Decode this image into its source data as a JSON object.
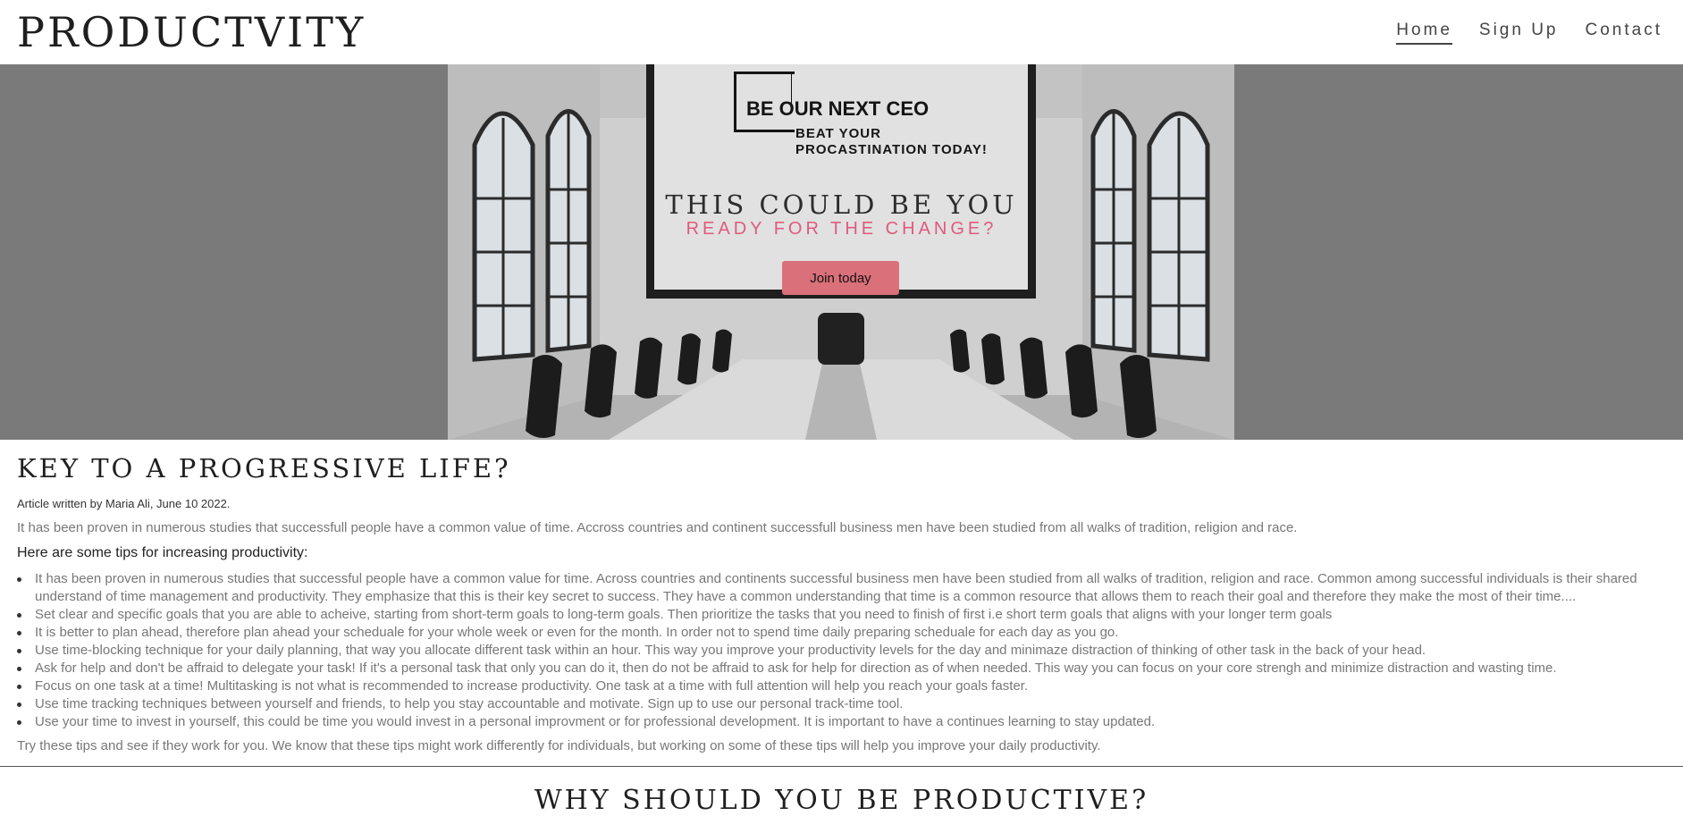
{
  "header": {
    "logo": "PRODUCTVITY",
    "nav": [
      {
        "label": "Home"
      },
      {
        "label": "Sign Up"
      },
      {
        "label": "Contact"
      }
    ]
  },
  "hero": {
    "image_text_line1": "BE OUR NEXT CEO",
    "image_text_line2": "BEAT YOUR",
    "image_text_line3": "PROCASTINATION TODAY!",
    "title": "THIS COULD BE YOU",
    "subtitle": "READY FOR THE CHANGE?",
    "button_label": "Join today"
  },
  "article": {
    "title": "KEY TO A PROGRESSIVE LIFE?",
    "byline": "Article written by Maria Ali, June 10 2022.",
    "intro": "It has been proven in numerous studies that successfull people have a common value of time. Accross countries and continent successfull business men have been studied from all walks of tradition, religion and race.",
    "tips_heading": "Here are some tips for increasing productivity:",
    "tips": [
      "It has been proven in numerous studies that successful people have a common value for time. Across countries and continents successful business men have been studied from all walks of tradition, religion and race. Common among successful individuals is their shared understand of time management and productivity. They emphasize that this is their key secret to success. They have a common understanding that time is a common resource that allows them to reach their goal and therefore they make the most of their time....",
      "Set clear and specific goals that you are able to acheive, starting from short-term goals to long-term goals. Then prioritize the tasks that you need to finish of first i.e short term goals that aligns with your longer term goals",
      "It is better to plan ahead, therefore plan ahead your scheduale for your whole week or even for the month. In order not to spend time daily preparing scheduale for each day as you go.",
      "Use time-blocking technique for your daily planning, that way you allocate different task within an hour. This way you improve your productivity levels for the day and minimaze distraction of thinking of other task in the back of your head.",
      "Ask for help and don't be affraid to delegate your task! If it's a personal task that only you can do it, then do not be affraid to ask for help for direction as of when needed. This way you can focus on your core strengh and minimize distraction and wasting time.",
      "Focus on one task at a time! Multitasking is not what is recommended to increase productivity. One task at a time with full attention will help you reach your goals faster.",
      "Use time tracking techniques between yourself and friends, to help you stay accountable and motivate. Sign up to use our personal track-time tool.",
      "Use your time to invest in yourself, this could be time you would invest in a personal improvment or for professional development. It is important to have a continues learning to stay updated."
    ],
    "closing": "Try these tips and see if they work for you. We know that these tips might work differently for individuals, but working on some of these tips will help you improve your daily productivity."
  },
  "next_section": {
    "title": "WHY SHOULD YOU BE PRODUCTIVE?"
  }
}
